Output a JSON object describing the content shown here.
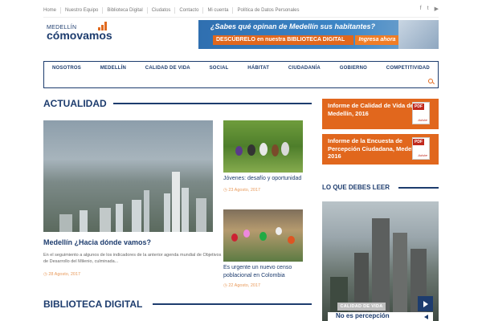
{
  "top_nav": [
    "Home",
    "Nuestro Equipo",
    "Biblioteca Digital",
    "Ciudatos",
    "Contacto",
    "Mi cuenta",
    "Política de Datos Personales"
  ],
  "social_icons": [
    "facebook-icon",
    "twitter-icon",
    "youtube-icon"
  ],
  "logo": {
    "small": "MEDELLÍN",
    "brand_a": "cómo",
    "brand_b": "vamos"
  },
  "banner": {
    "headline": "¿Sabes qué opinan de Medellín sus habitantes?",
    "cta_text": "DESCÚBRELO en nuestra BIBLIOTECA DIGITAL",
    "button": "Ingresa ahora"
  },
  "main_nav": [
    "NOSOTROS",
    "MEDELLÍN",
    "CALIDAD DE VIDA",
    "SOCIAL",
    "HÁBITAT",
    "CIUDADANÍA",
    "GOBIERNO",
    "COMPETITIVIDAD"
  ],
  "sections": {
    "actualidad": "ACTUALIDAD",
    "biblioteca": "BIBLIOTECA DIGITAL",
    "lo_que": "LO QUE DEBES LEER"
  },
  "feature": {
    "title": "Medellín ¿Hacia dónde vamos?",
    "excerpt": "En el seguimiento a algunos de los indicadores de la anterior agenda mundial de Objetivos de Desarrollo del Milenio, culminada...",
    "date": "28 Agosto, 2017"
  },
  "side_posts": [
    {
      "title": "Jóvenes: desafío y oportunidad",
      "date": "23 Agosto, 2017"
    },
    {
      "title": "Es urgente un nuevo censo poblacional en Colombia",
      "date": "22 Agosto, 2017"
    }
  ],
  "pdf_boxes": [
    {
      "text": "Informe de Calidad de Vida de Medellín, 2016",
      "label": "PDF",
      "brand": "Adobe"
    },
    {
      "text": "Informe de la Encuesta de Percepción Ciudadana, Medellín 2016",
      "label": "PDF",
      "brand": "Adobe"
    }
  ],
  "lo_que": {
    "category": "CALIDAD DE VIDA",
    "title": "No es percepción"
  }
}
